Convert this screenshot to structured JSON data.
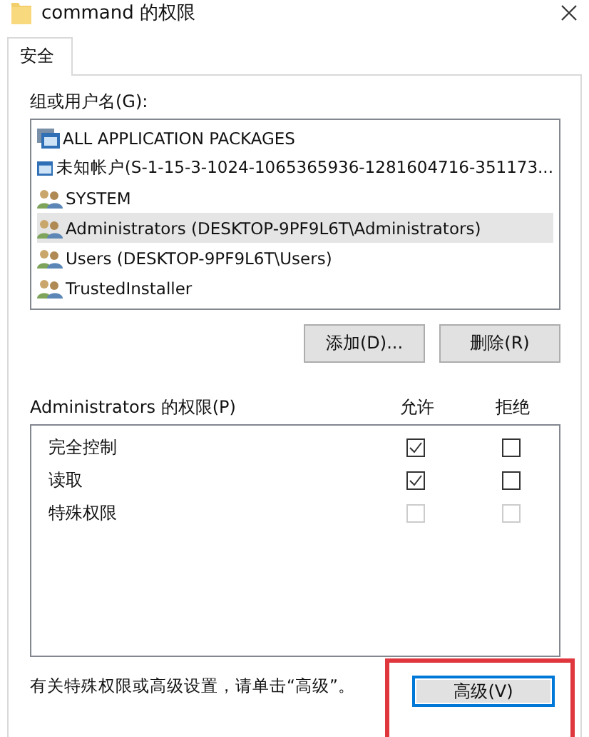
{
  "window": {
    "title": "command 的权限"
  },
  "tabs": [
    {
      "label": "安全",
      "selected": true
    }
  ],
  "group_label": "组或用户名(G):",
  "principals": [
    {
      "name": "ALL APPLICATION PACKAGES",
      "kind": "package",
      "selected": false
    },
    {
      "name": "未知帐户(S-1-15-3-1024-1065365936-1281604716-351173...",
      "kind": "account",
      "selected": false
    },
    {
      "name": "SYSTEM",
      "kind": "group",
      "selected": false
    },
    {
      "name": "Administrators (DESKTOP-9PF9L6T\\Administrators)",
      "kind": "group",
      "selected": true
    },
    {
      "name": "Users (DESKTOP-9PF9L6T\\Users)",
      "kind": "group",
      "selected": false
    },
    {
      "name": "TrustedInstaller",
      "kind": "group",
      "selected": false
    }
  ],
  "principal_buttons": [
    "添加(D)...",
    "删除(R)"
  ],
  "permissions_label": "Administrators 的权限(P)",
  "columns": [
    "允许",
    "拒绝"
  ],
  "permissions": [
    {
      "name": "完全控制",
      "allow": {
        "checked": true,
        "disabled": false
      },
      "deny": {
        "checked": false,
        "disabled": false
      }
    },
    {
      "name": "读取",
      "allow": {
        "checked": true,
        "disabled": false
      },
      "deny": {
        "checked": false,
        "disabled": false
      }
    },
    {
      "name": "特殊权限",
      "allow": {
        "checked": false,
        "disabled": true
      },
      "deny": {
        "checked": false,
        "disabled": true
      }
    }
  ],
  "note": "有关特殊权限或高级设置，请单击“高级”。",
  "advanced_button": {
    "label": "高级(V)",
    "highlighted": true
  }
}
